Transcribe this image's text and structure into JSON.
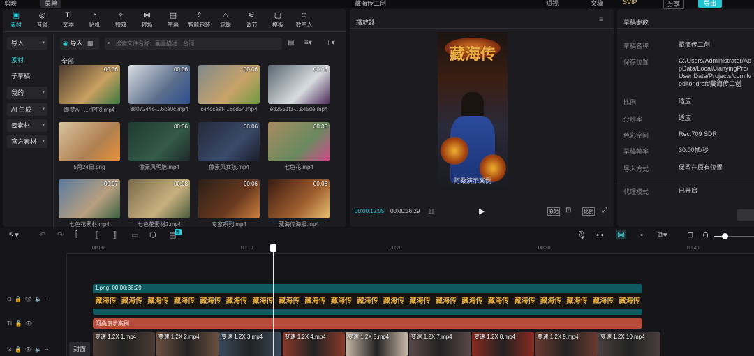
{
  "topbar": {
    "menu": "菜单",
    "project": "藏海传二创",
    "vip": "SVIP",
    "actions": [
      "短视",
      "文稿",
      "分享",
      "导出"
    ]
  },
  "tabs": [
    {
      "label": "素材",
      "icon": "▣",
      "active": true
    },
    {
      "label": "音频",
      "icon": "◎"
    },
    {
      "label": "文本",
      "icon": "TI"
    },
    {
      "label": "贴纸",
      "icon": "◔"
    },
    {
      "label": "特效",
      "icon": "✧"
    },
    {
      "label": "转场",
      "icon": "⋈"
    },
    {
      "label": "字幕",
      "icon": "▤"
    },
    {
      "label": "智能包装",
      "icon": "⇪"
    },
    {
      "label": "滤镜",
      "icon": "⌂"
    },
    {
      "label": "调节",
      "icon": "⚟"
    },
    {
      "label": "模板",
      "icon": "▢"
    },
    {
      "label": "数字人",
      "icon": "☺"
    }
  ],
  "sidebar": {
    "items": [
      {
        "label": "导入",
        "box": true
      },
      {
        "label": "素材",
        "active": true
      },
      {
        "label": "子草稿"
      },
      {
        "label": "我的",
        "box": true
      },
      {
        "label": "AI 生成",
        "box": true
      },
      {
        "label": "云素材",
        "box": true
      },
      {
        "label": "官方素材",
        "box": true
      }
    ]
  },
  "media_toolbar": {
    "import_label": "导入",
    "search_placeholder": "搜索文件名称、画面描述、台词",
    "section_all": "全部"
  },
  "media": [
    {
      "name": "即梦AI -...rfPF8.mp4",
      "duration": "00:06",
      "colors": [
        "#4a3a2e",
        "#c8a060",
        "#3a7a40"
      ]
    },
    {
      "name": "8807244c-...6ca0c.mp4",
      "duration": "00:06",
      "colors": [
        "#d9dce2",
        "#5c6f8c",
        "#2d4d90"
      ]
    },
    {
      "name": "c44ccaaf-...8cd54.mp4",
      "duration": "00:06",
      "colors": [
        "#7f8a8c",
        "#c9a36a",
        "#6e9a40"
      ]
    },
    {
      "name": "e82551f3-...a45de.mp4",
      "duration": "00:06",
      "colors": [
        "#5a6670",
        "#d8dde0",
        "#4b2a5a"
      ]
    },
    {
      "name": "5月24日.png",
      "duration": "",
      "colors": [
        "#d8c3a0",
        "#b08050",
        "#e8913a"
      ]
    },
    {
      "name": "像素风明旭.mp4",
      "duration": "00:06",
      "colors": [
        "#203a30",
        "#345a4a",
        "#1e2a28"
      ]
    },
    {
      "name": "像素风女孩.mp4",
      "duration": "00:06",
      "colors": [
        "#242a3a",
        "#3a4a6a",
        "#1a1e2a"
      ]
    },
    {
      "name": "七色花.mp4",
      "duration": "00:06",
      "colors": [
        "#a88a60",
        "#6a8a60",
        "#d04a8a"
      ]
    },
    {
      "name": "七色花素材.mp4",
      "duration": "00:07",
      "colors": [
        "#5a7aa0",
        "#b8a080",
        "#3a6040"
      ]
    },
    {
      "name": "七色花素材2.mp4",
      "duration": "00:08",
      "colors": [
        "#7a6a4a",
        "#c8b080",
        "#4a5a3a"
      ]
    },
    {
      "name": "专家系列.mp4",
      "duration": "00:06",
      "colors": [
        "#2a1e16",
        "#6a3a20",
        "#d08040"
      ]
    },
    {
      "name": "藏海传海报.mp4",
      "duration": "00:06",
      "colors": [
        "#3a1a10",
        "#a06030",
        "#e8c070"
      ]
    }
  ],
  "player": {
    "title": "播放器",
    "current": "00:00:12:05",
    "total": "00:00:36:29",
    "poster_title": "藏海传",
    "watermark": "阿桑演示案例",
    "btns": [
      "原始",
      "比例"
    ]
  },
  "props": {
    "title": "草稿参数",
    "rows": [
      {
        "label": "草稿名称",
        "value": "藏海传二创"
      },
      {
        "label": "保存位置",
        "value": "C:/Users/Administrator/AppData/Local/JianyingPro/User Data/Projects/com.lveditor.draft/藏海传二创"
      },
      {
        "label": "比例",
        "value": "适应"
      },
      {
        "label": "分辨率",
        "value": "适应"
      },
      {
        "label": "色彩空间",
        "value": "Rec.709 SDR"
      },
      {
        "label": "草稿帧率",
        "value": "30.00帧/秒"
      },
      {
        "label": "导入方式",
        "value": "保留在原有位置"
      },
      {
        "label": "代理模式",
        "value": "已开启"
      }
    ]
  },
  "timeline": {
    "ticks": [
      "00:00",
      "00:10",
      "00:20",
      "00:30",
      "00:40"
    ],
    "new_badge": "新",
    "video_track": {
      "label": "1.png",
      "duration": "00:00:36:29",
      "frame_text": "藏海传"
    },
    "text_track": {
      "label": "阿桑演示案例"
    },
    "main_clips": [
      "变速 1.2X 1.mp4",
      "变速 1.2X 2.mp4",
      "变速 1.2X 3.mp4",
      "变速 1.2X 4.mp4",
      "变速 1.2X 5.mp4",
      "变速 1.2X 7.mp4",
      "变速 1.2X 8.mp4",
      "变速 1.2X 9.mp4",
      "变速 1.2X 10.mp4"
    ],
    "cover": "封面"
  }
}
